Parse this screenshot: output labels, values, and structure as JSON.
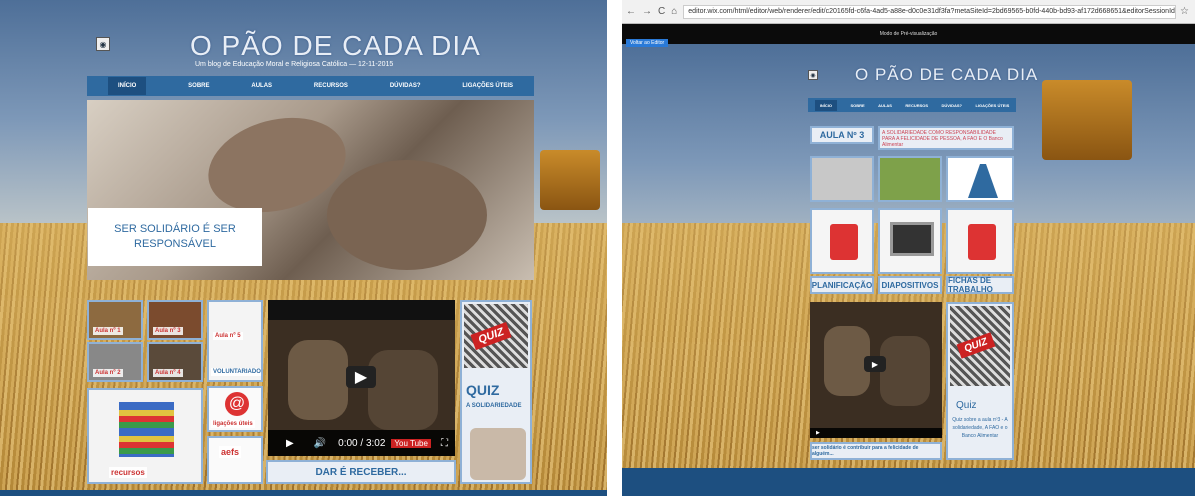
{
  "site": {
    "title": "O PÃO DE CADA DIA",
    "subtitle_left": "Um blog de Educação Moral e Religiosa Católica — 12-11-2015",
    "logo_glyph": "◉"
  },
  "nav": {
    "items": [
      "INÍCIO",
      "SOBRE",
      "AULAS",
      "RECURSOS",
      "DÚVIDAS?",
      "LIGAÇÕES ÚTEIS"
    ]
  },
  "hero": {
    "caption": "SER SOLIDÁRIO É SER RESPONSÁVEL"
  },
  "tiles_left": [
    {
      "label": "Aula nº 1"
    },
    {
      "label": "Aula nº 2"
    },
    {
      "label": "Aula nº 3"
    },
    {
      "label": "Aula nº 4"
    },
    {
      "label": "Aula nº 5"
    },
    {
      "label": "VOLUNTARIADO"
    },
    {
      "label": "recursos"
    },
    {
      "label": "ligações úteis"
    },
    {
      "label": "aefs"
    }
  ],
  "video_left": {
    "time": "0:00 / 3:02",
    "brand": "You Tube"
  },
  "button_left": "DAR É RECEBER...",
  "quiz_left": {
    "badge": "QUIZ",
    "title": "QUIZ",
    "subtitle": "A SOLIDARIEDADE"
  },
  "browser": {
    "url": "editor.wix.com/html/editor/web/renderer/edit/c20165fd-c6fa-4ad5-a88e-d0c0e31df3fa?metaSiteId=2bd69565-b0fd-440b-bd93-af172d668651&editorSessionId=",
    "editor_button": "Voltar ao Editor",
    "editor_center": "Modo de Pré-visualização"
  },
  "right_page": {
    "lesson_title": "AULA Nº 3",
    "lesson_desc": "A SOLIDARIEDADE COMO RESPONSABILIDADE PARA A FELICIDADE DE PESSOA, A FAO E O Banco Alimentar",
    "labels": [
      "PLANIFICAÇÃO",
      "DIAPOSITIVOS",
      "FICHAS DE TRABALHO"
    ],
    "video_caption": "ser solidário é contribuir para a felicidade de alguém...",
    "quiz_badge": "QUIZ",
    "quiz_title": "Quiz",
    "quiz_text": "Quiz sobre a aula nº3 - A solidariedade, A FAO e o Banco Alimentar"
  },
  "colors": {
    "nav_blue": "#2f6aa0",
    "accent_red": "#c22",
    "panel_border": "#8fb1d6"
  }
}
